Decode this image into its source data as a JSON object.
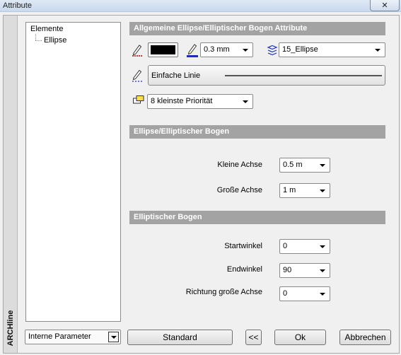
{
  "window": {
    "title": "Attribute",
    "close_glyph": "✕"
  },
  "brand": "ARCHline",
  "tree": {
    "root": "Elemente",
    "child": "Ellipse"
  },
  "sections": {
    "general": "Allgemeine Ellipse/Elliptischer Bogen Attribute",
    "ellipse": "Ellipse/Elliptischer Bogen",
    "arc": "Elliptischer Bogen"
  },
  "general": {
    "pen_color": "#000000",
    "pen_width": "0.3 mm",
    "layer": "15_Ellipse",
    "line_type": "Einfache Linie",
    "priority": "8 kleinste Priorität"
  },
  "ellipse": {
    "minor_axis_label": "Kleine Achse",
    "minor_axis_value": "0.5 m",
    "major_axis_label": "Große Achse",
    "major_axis_value": "1 m"
  },
  "arc": {
    "start_label": "Startwinkel",
    "start_value": "0",
    "end_label": "Endwinkel",
    "end_value": "90",
    "direction_label": "Richtung große Achse",
    "direction_value": "0"
  },
  "footer": {
    "params": "Interne Parameter",
    "standard": "Standard",
    "back": "<<",
    "ok": "Ok",
    "cancel": "Abbrechen"
  },
  "icons": [
    "pen-color-icon",
    "pen-width-icon",
    "layer-icon",
    "line-type-icon",
    "priority-icon",
    "close-icon",
    "chevron-down-icon"
  ]
}
